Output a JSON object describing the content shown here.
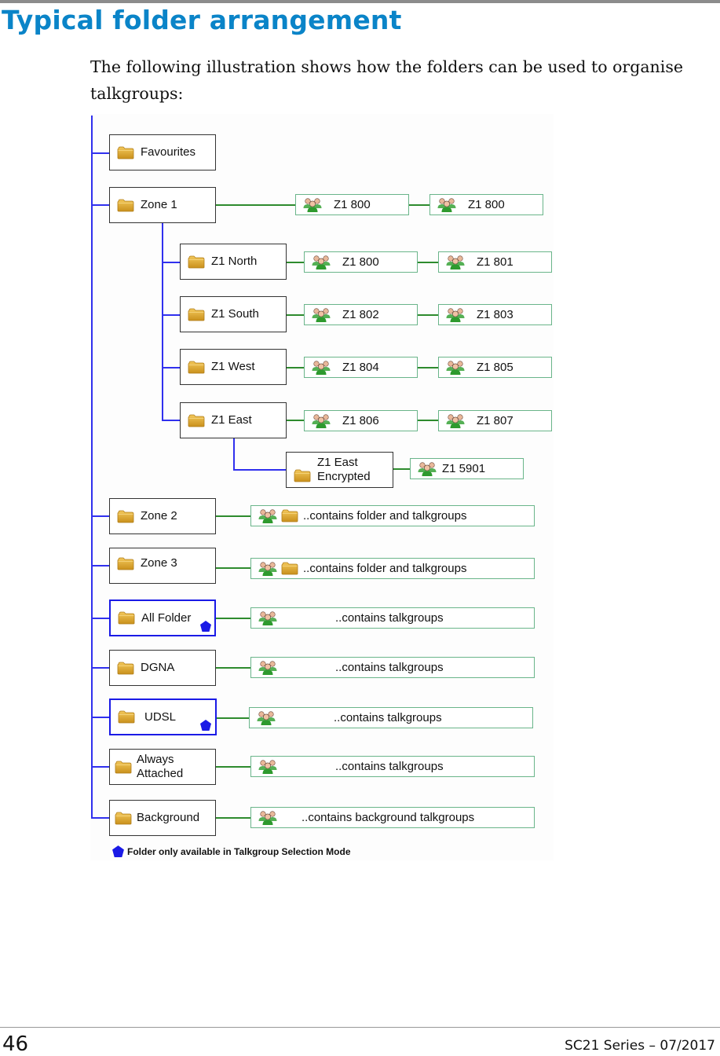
{
  "page": {
    "title": "Typical folder arrangement",
    "intro": "The following illustration shows how the folders can be used to organise talkgroups:",
    "page_number": "46",
    "series": "SC21 Series – 07/2017"
  },
  "colors": {
    "title": "#0a84c8",
    "tree_line": "#3030ee",
    "talkgroup_line": "#2e8b2e",
    "talkgroup_border": "#6ab58a",
    "marker": "#1a1ae6"
  },
  "diagram": {
    "folders": {
      "favourites": "Favourites",
      "zone1": "Zone 1",
      "z1_north": "Z1 North",
      "z1_south": "Z1 South",
      "z1_west": "Z1 West",
      "z1_east": "Z1 East",
      "z1_east_encrypted_l1": "Z1 East",
      "z1_east_encrypted_l2": "Encrypted",
      "zone2": "Zone 2",
      "zone3": "Zone 3",
      "all_folder": "All Folder",
      "dgna": "DGNA",
      "udsl": "UDSL",
      "always_attached_l1": "Always",
      "always_attached_l2": "Attached",
      "background": "Background"
    },
    "talkgroups": {
      "zone1_a": "Z1 800",
      "zone1_b": "Z1 800",
      "north_a": "Z1 800",
      "north_b": "Z1 801",
      "south_a": "Z1 802",
      "south_b": "Z1 803",
      "west_a": "Z1 804",
      "west_b": "Z1 805",
      "east_a": "Z1 806",
      "east_b": "Z1 807",
      "encrypted_a": "Z1 5901",
      "zone2": "..contains folder and talkgroups",
      "zone3": "..contains folder and talkgroups",
      "all_folder": "..contains talkgroups",
      "dgna": "..contains talkgroups",
      "udsl": "..contains talkgroups",
      "always_attached": "..contains talkgroups",
      "background": "..contains background talkgroups"
    },
    "legend": "Folder only available in Talkgroup Selection Mode",
    "icons": {
      "folder": "folder-icon",
      "talkgroup": "talkgroup-people-icon",
      "marker": "blue-pentagon"
    }
  }
}
